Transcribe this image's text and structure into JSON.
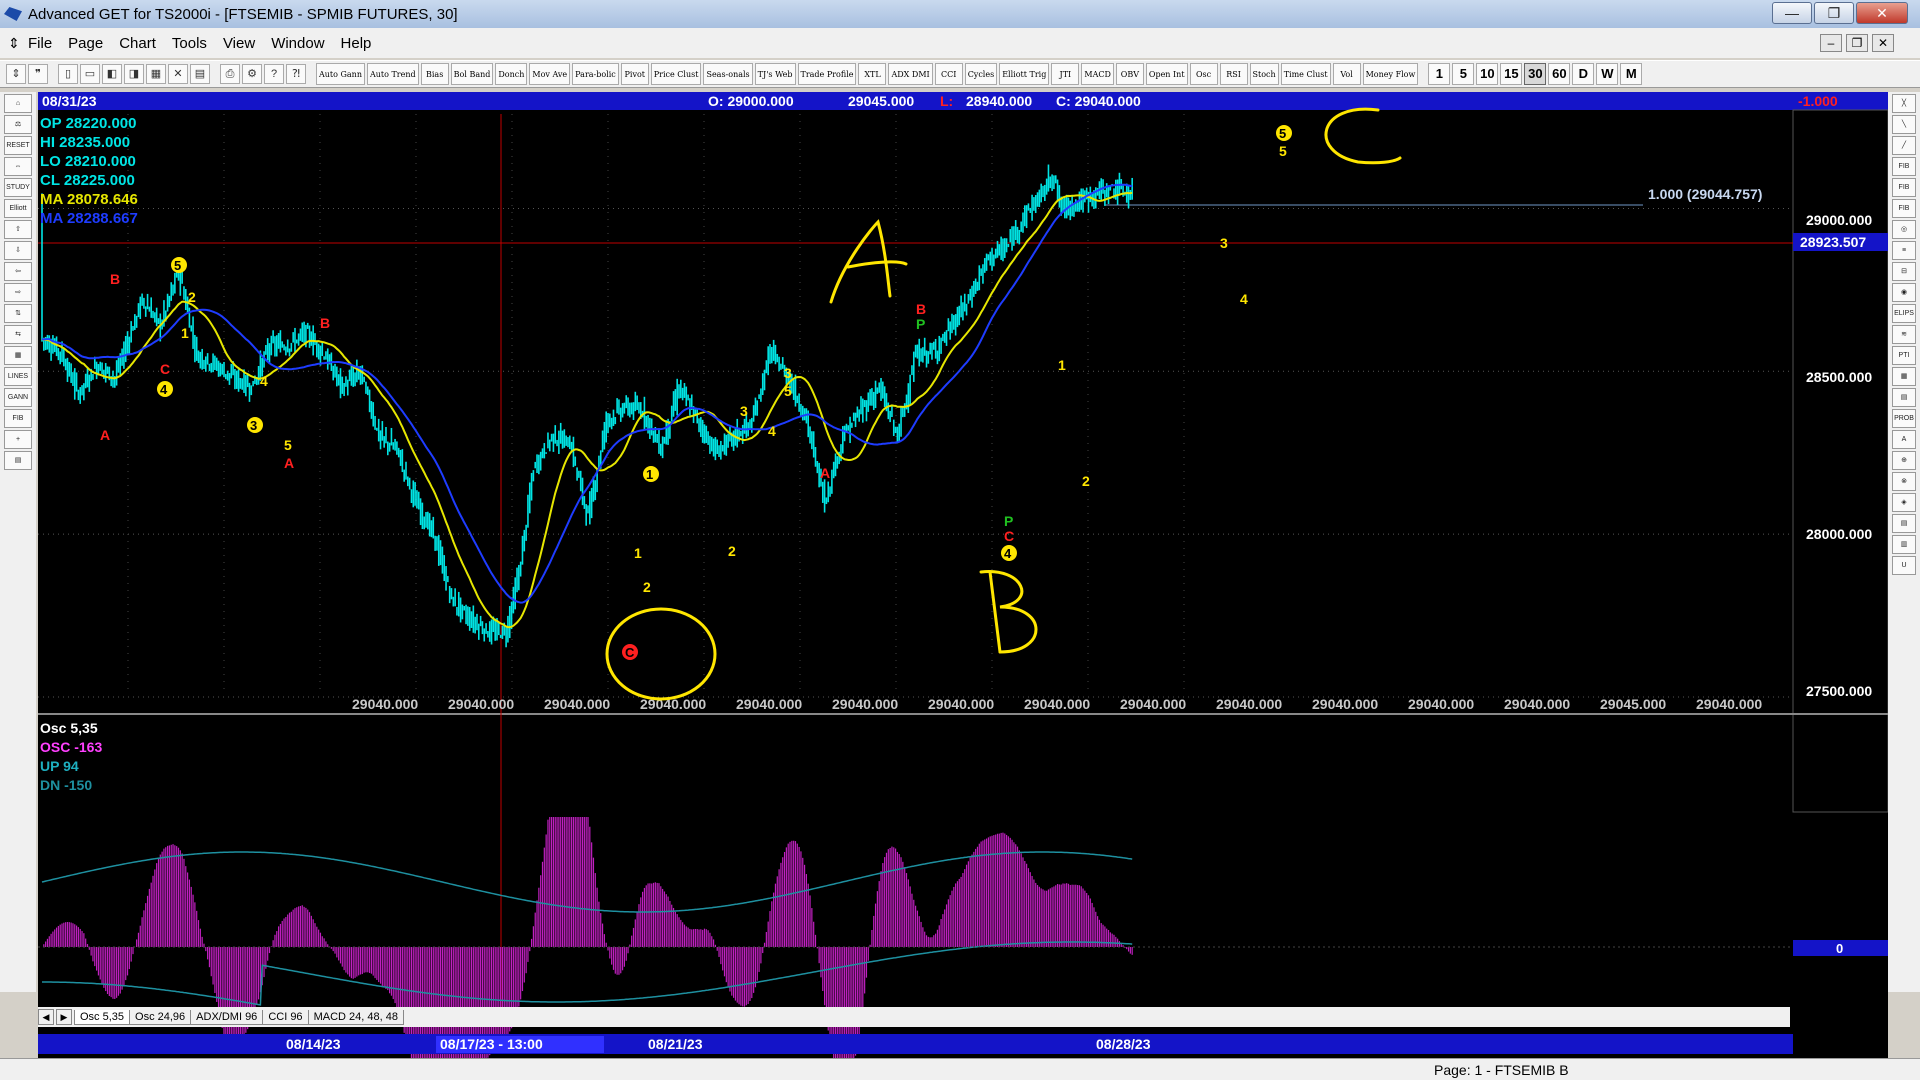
{
  "window": {
    "title": "Advanced GET for TS2000i - [FTSEMIB - SPMIB FUTURES, 30]",
    "minimize": "—",
    "restore": "❐",
    "close": "✕",
    "mdi_min": "–",
    "mdi_restore": "❐",
    "mdi_close": "✕"
  },
  "menu": [
    "File",
    "Page",
    "Chart",
    "Tools",
    "View",
    "Window",
    "Help"
  ],
  "toolbar": {
    "study_buttons": [
      "Auto Gann",
      "Auto Trend",
      "Bias",
      "Bol Band",
      "Donch",
      "Mov Ave",
      "Para-bolic",
      "Pivot",
      "Price Clust",
      "Seas-onals",
      "TJ's Web",
      "Trade Profile",
      "XTL",
      "ADX DMI",
      "CCI",
      "Cycles",
      "Elliott Trig",
      "JTI",
      "MACD",
      "OBV",
      "Open Int",
      "Osc",
      "RSI",
      "Stoch",
      "Time Clust",
      "Vol",
      "Money Flow"
    ],
    "periods": [
      "1",
      "5",
      "10",
      "15",
      "30",
      "60",
      "D",
      "W",
      "M"
    ],
    "active_period": "30"
  },
  "left_tools": [
    "⌂",
    "⚖",
    "RESET",
    "⇔",
    "STUDY",
    "Elliott",
    "⇧",
    "⇩",
    "⇦",
    "⇨",
    "⇅",
    "⇆",
    "▦",
    "LINES",
    "GANN",
    "FIB",
    "+",
    "▤"
  ],
  "right_tools": [
    "╳",
    "╲",
    "╱",
    "FIB RET",
    "FIB EXT",
    "FIB TIME",
    "◎",
    "≡",
    "⊟",
    "◉",
    "ELIPS",
    "≋",
    "PTI",
    "▦",
    "▤",
    "PROB",
    "A",
    "⊕",
    "⊗",
    "◈",
    "▤",
    "▥",
    "U"
  ],
  "header": {
    "date": "08/31/23",
    "open": "O: 29000.000",
    "high": "29045.000",
    "low_label": "L:",
    "low": "28940.000",
    "close": "C: 29040.000",
    "change": "-1.000"
  },
  "legend": [
    {
      "label": "OP",
      "value": "28220.000",
      "color": "#00e5e5"
    },
    {
      "label": "HI",
      "value": "28235.000",
      "color": "#00e5e5"
    },
    {
      "label": "LO",
      "value": "28210.000",
      "color": "#00e5e5"
    },
    {
      "label": "CL",
      "value": "28225.000",
      "color": "#00e5e5"
    },
    {
      "label": "MA",
      "value": "28078.646",
      "color": "#e6e600"
    },
    {
      "label": "MA",
      "value": "28288.667",
      "color": "#1e3cff"
    }
  ],
  "price_axis": {
    "labels": [
      "29000.000",
      "28500.000",
      "28000.000",
      "27500.000"
    ],
    "crosshair_price": "28923.507",
    "fib_label": "1.000 (29044.757)"
  },
  "time_readout": [
    "29040.000",
    "29040.000",
    "29040.000",
    "29040.000",
    "29040.000",
    "29040.000",
    "29040.000",
    "29040.000",
    "29040.000",
    "29040.000",
    "29040.000",
    "29040.000",
    "29040.000",
    "29045.000",
    "29040.000"
  ],
  "wave_labels": [
    {
      "text": "B",
      "color": "#ff2020"
    },
    {
      "text": "5",
      "color": "#ffe600"
    },
    {
      "text": "2",
      "color": "#ffe600"
    },
    {
      "text": "1",
      "color": "#ffe600"
    },
    {
      "text": "C",
      "color": "#ff2020"
    },
    {
      "text": "4",
      "color": "#ffe600"
    },
    {
      "text": "A",
      "color": "#ff2020"
    },
    {
      "text": "B",
      "color": "#ff2020"
    },
    {
      "text": "4",
      "color": "#ffe600"
    },
    {
      "text": "3",
      "color": "#ffe600"
    },
    {
      "text": "5",
      "color": "#ffe600"
    },
    {
      "text": "A",
      "color": "#ff2020"
    },
    {
      "text": "1",
      "color": "#ffe600"
    },
    {
      "text": "1",
      "color": "#ffe600"
    },
    {
      "text": "2",
      "color": "#ffe600"
    },
    {
      "text": "C",
      "color": "#ff2020"
    },
    {
      "text": "2",
      "color": "#ffe600"
    },
    {
      "text": "3",
      "color": "#ffe600"
    },
    {
      "text": "4",
      "color": "#ffe600"
    },
    {
      "text": "3",
      "color": "#ffe600"
    },
    {
      "text": "5",
      "color": "#ffe600"
    },
    {
      "text": "A",
      "color": "#ff2020"
    },
    {
      "text": "B",
      "color": "#ff2020"
    },
    {
      "text": "P",
      "color": "#20c020"
    },
    {
      "text": "P",
      "color": "#20c020"
    },
    {
      "text": "C",
      "color": "#ff2020"
    },
    {
      "text": "4",
      "color": "#ffe600"
    },
    {
      "text": "1",
      "color": "#ffe600"
    },
    {
      "text": "2",
      "color": "#ffe600"
    },
    {
      "text": "3",
      "color": "#ffe600"
    },
    {
      "text": "4",
      "color": "#ffe600"
    },
    {
      "text": "5",
      "color": "#ffe600"
    },
    {
      "text": "5",
      "color": "#ffe600"
    }
  ],
  "handwritten": [
    "A",
    "B",
    "C"
  ],
  "oscillator": {
    "title": "Osc 5,35",
    "osc": "OSC -163",
    "up": "UP   94",
    "dn": "DN   -150",
    "zero": "0"
  },
  "tabs": [
    "Osc 5,35",
    "Osc 24,96",
    "ADX/DMI 96",
    "CCI 96",
    "MACD 24, 48, 48"
  ],
  "date_axis": [
    "08/14/23",
    "08/17/23 - 13:00",
    "08/21/23",
    "08/28/23"
  ],
  "status": {
    "page": "Page: 1 - FTSEMIB B"
  },
  "colors": {
    "candle": "#00e5e5",
    "ma_fast": "#e6e600",
    "ma_slow": "#1e3cff",
    "osc": "#c020c0",
    "crosshair": "#c00000",
    "annot": "#ffe600"
  }
}
